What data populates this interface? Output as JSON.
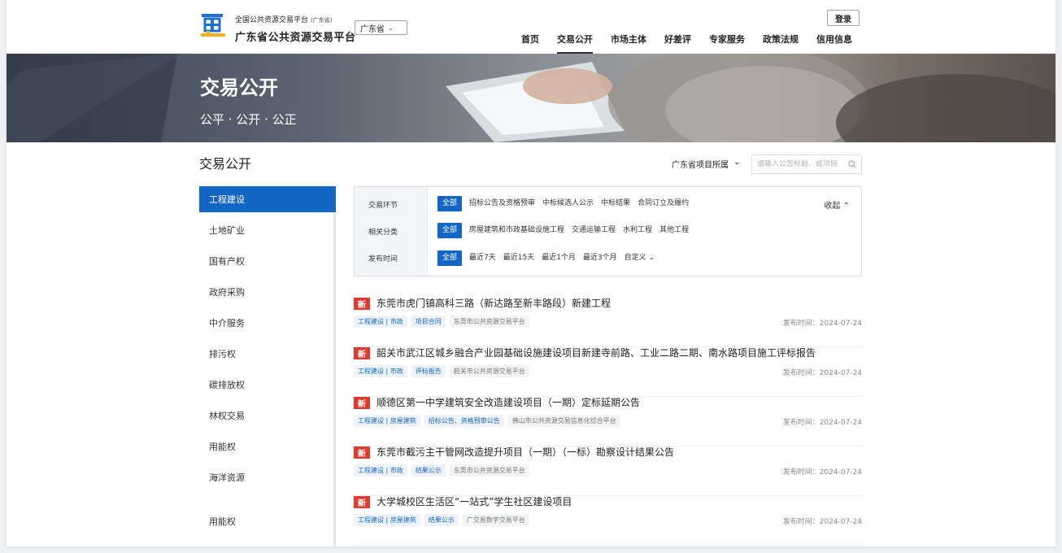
{
  "header": {
    "platform_small": "全国公共资源交易平台",
    "platform_tag": "(广东省)",
    "platform_name": "广东省公共资源交易平台",
    "province_select": "广东省",
    "nav": [
      "首页",
      "交易公开",
      "市场主体",
      "好差评",
      "专家服务",
      "政策法规",
      "信用信息"
    ],
    "active_nav": "交易公开",
    "login": "登录"
  },
  "banner": {
    "title": "交易公开",
    "subtitle": "公平 · 公开 · 公正"
  },
  "section": {
    "title": "交易公开",
    "region_filter": "广东省项目所属",
    "search_placeholder": "请输入公告标题、或项目"
  },
  "sidebar": {
    "items": [
      "工程建设",
      "土地矿业",
      "国有产权",
      "政府采购",
      "中介服务",
      "排污权",
      "碳排放权",
      "林权交易",
      "用能权",
      "海洋资源",
      "用能权"
    ],
    "active": "工程建设"
  },
  "filters": {
    "collapse": "收起",
    "rows": [
      {
        "label": "交易环节",
        "options": [
          "全部",
          "招标公告及资格预审",
          "中标候选人公示",
          "中标结果",
          "合同订立及履约"
        ]
      },
      {
        "label": "相关分类",
        "options": [
          "全部",
          "房屋建筑和市政基础设施工程",
          "交通运输工程",
          "水利工程",
          "其他工程"
        ]
      },
      {
        "label": "发布时间",
        "options": [
          "全部",
          "最近7天",
          "最近15天",
          "最近1个月",
          "最近3个月",
          "自定义"
        ]
      }
    ]
  },
  "list": {
    "badge": "新",
    "items": [
      {
        "title": "东莞市虎门镇高科三路（新达路至新丰路段）新建工程",
        "tags": [
          "工程建设 | 市政",
          "项目合同",
          "东莞市公共资源交易平台"
        ],
        "time": "发布时间：2024-07-24"
      },
      {
        "title": "韶关市武江区城乡融合产业园基础设施建设项目新建寺前路、工业二路二期、南水路项目施工评标报告",
        "tags": [
          "工程建设 | 市政",
          "评标报告",
          "韶关市公共资源交易平台"
        ],
        "time": "发布时间：2024-07-24"
      },
      {
        "title": "顺德区第一中学建筑安全改造建设项目（一期）定标延期公告",
        "tags": [
          "工程建设 | 房屋建筑",
          "招标公告、资格预审公告",
          "佛山市公共资源交易信息化综合平台"
        ],
        "time": "发布时间：2024-07-24"
      },
      {
        "title": "东莞市截污主干管网改造提升项目（一期）（一标）勘察设计结果公告",
        "tags": [
          "工程建设 | 市政",
          "结果公示",
          "东莞市公共资源交易平台"
        ],
        "time": "发布时间：2024-07-24"
      },
      {
        "title": "大学城校区生活区“一站式”学生社区建设项目",
        "tags": [
          "工程建设 | 房屋建筑",
          "结果公示",
          "广交易数字交易平台"
        ],
        "time": "发布时间：2024-07-24"
      }
    ]
  },
  "colors": {
    "accent": "#1466c6",
    "badge": "#e23a2e"
  },
  "icons": [
    "logo-icon",
    "chevron-down-icon",
    "search-icon",
    "chevron-up-icon"
  ]
}
